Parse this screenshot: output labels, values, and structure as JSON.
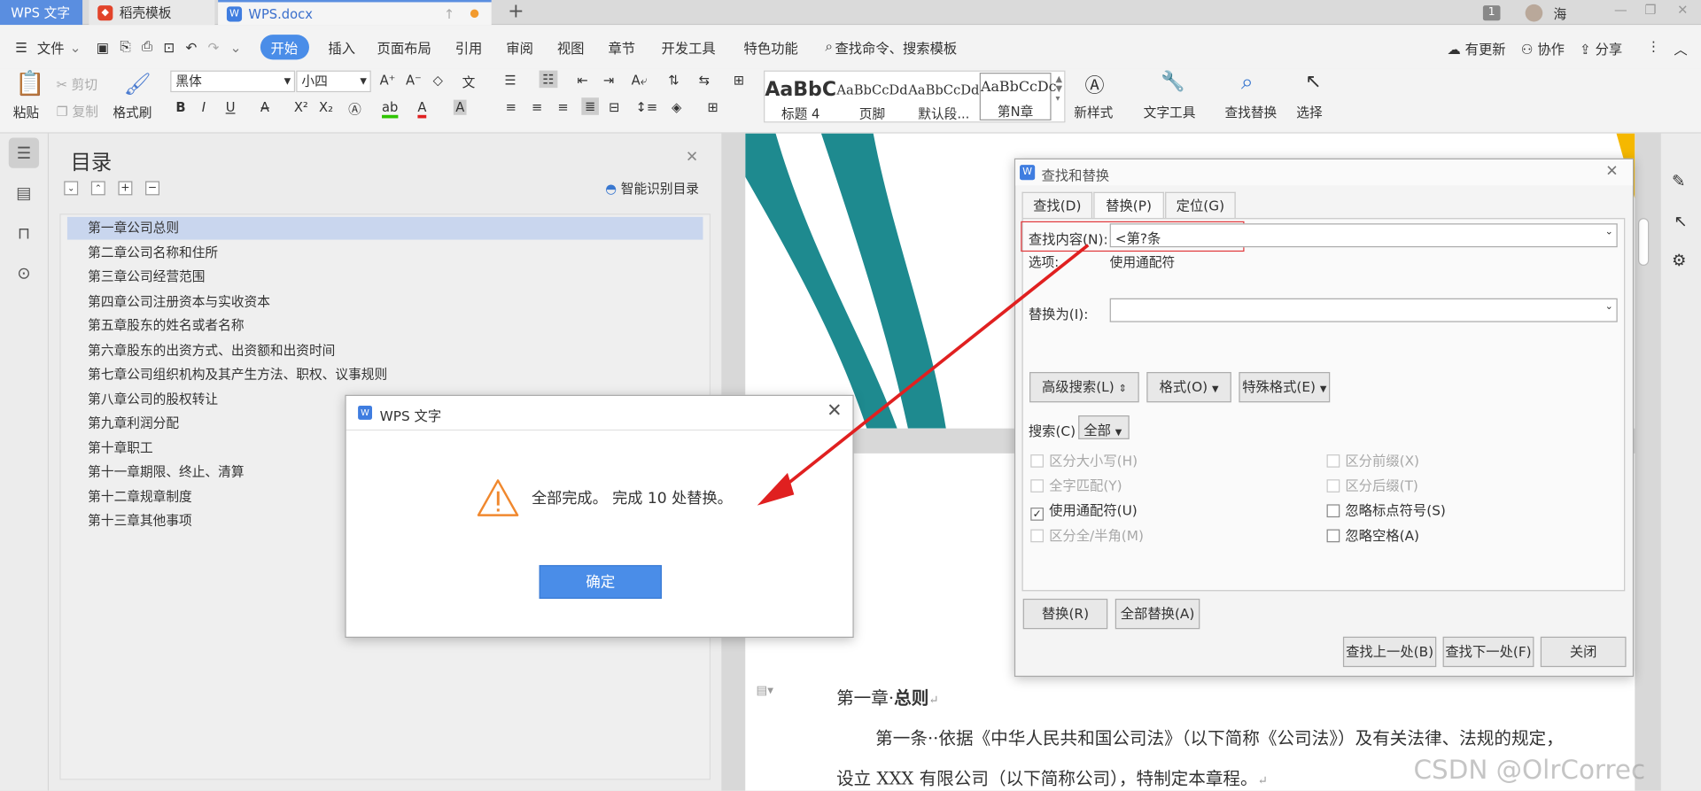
{
  "tabs": [
    {
      "label": "WPS 文字"
    },
    {
      "label": "稻壳模板"
    },
    {
      "label": "WPS.docx"
    }
  ],
  "window": {
    "notify_count": "1",
    "user_name": "海"
  },
  "menu": {
    "file": "文件",
    "items": [
      "开始",
      "插入",
      "页面布局",
      "引用",
      "审阅",
      "视图",
      "章节",
      "开发工具",
      "特色功能"
    ],
    "search": "查找命令、搜索模板",
    "update": "有更新",
    "collab": "协作",
    "share": "分享"
  },
  "ribbon": {
    "paste": "粘贴",
    "cut": "剪切",
    "copy": "复制",
    "format_painter": "格式刷",
    "font_name": "黑体",
    "font_size": "小四",
    "styles": [
      {
        "preview": "AaBbC",
        "name": "标题 4"
      },
      {
        "preview": "AaBbCcDd",
        "name": "页脚"
      },
      {
        "preview": "AaBbCcDd",
        "name": "默认段..."
      },
      {
        "preview": "AaBbCcDc",
        "name": "第N章"
      }
    ],
    "new_style": "新样式",
    "text_tools": "文字工具",
    "find_replace": "查找替换",
    "select": "选择"
  },
  "toc": {
    "title": "目录",
    "smart": "智能识别目录",
    "items": [
      "第一章公司总则",
      "第二章公司名称和住所",
      "第三章公司经营范围",
      "第四章公司注册资本与实收资本",
      "第五章股东的姓名或者名称",
      "第六章股东的出资方式、出资额和出资时间",
      "第七章公司组织机构及其产生方法、职权、议事规则",
      "第八章公司的股权转让",
      "第九章利润分配",
      "第十章职工",
      "第十一章期限、终止、清算",
      "第十二章规章制度",
      "第十三章其他事项"
    ]
  },
  "document": {
    "heading_prefix": "第一章",
    "heading": "总则",
    "para1": "第一条··依据《中华人民共和国公司法》（以下简称《公司法》）及有关法律、法规的规定，",
    "para2": "设立 XXX 有限公司（以下简称公司），特制定本章程。",
    "watermark": "CSDN @OlrCorrec"
  },
  "find_dialog": {
    "title": "查找和替换",
    "tabs": [
      "查找(D)",
      "替换(P)",
      "定位(G)"
    ],
    "find_label": "查找内容(N):",
    "find_value": "<第?条",
    "options_label": "选项:",
    "options_value": "使用通配符",
    "replace_label": "替换为(I):",
    "replace_value": "",
    "advanced": "高级搜索(L)",
    "format": "格式(O)",
    "special": "特殊格式(E)",
    "search_label": "搜索(C)",
    "search_scope": "全部",
    "checks": [
      {
        "label": "区分大小写(H)",
        "checked": false,
        "enabled": false
      },
      {
        "label": "区分前缀(X)",
        "checked": false,
        "enabled": false
      },
      {
        "label": "全字匹配(Y)",
        "checked": false,
        "enabled": false
      },
      {
        "label": "区分后缀(T)",
        "checked": false,
        "enabled": false
      },
      {
        "label": "使用通配符(U)",
        "checked": true,
        "enabled": true
      },
      {
        "label": "忽略标点符号(S)",
        "checked": false,
        "enabled": true
      },
      {
        "label": "区分全/半角(M)",
        "checked": false,
        "enabled": false
      },
      {
        "label": "忽略空格(A)",
        "checked": false,
        "enabled": true
      }
    ],
    "replace_btn": "替换(R)",
    "replace_all_btn": "全部替换(A)",
    "find_prev": "查找上一处(B)",
    "find_next": "查找下一处(F)",
    "close": "关闭"
  },
  "msgbox": {
    "title": "WPS 文字",
    "message": "全部完成。 完成 10 处替换。",
    "ok": "确定"
  },
  "colors": {
    "accent": "#4a8de8",
    "highlight_box": "#e0383b",
    "arrow": "#e02020",
    "teal": "#1e8a8f"
  }
}
